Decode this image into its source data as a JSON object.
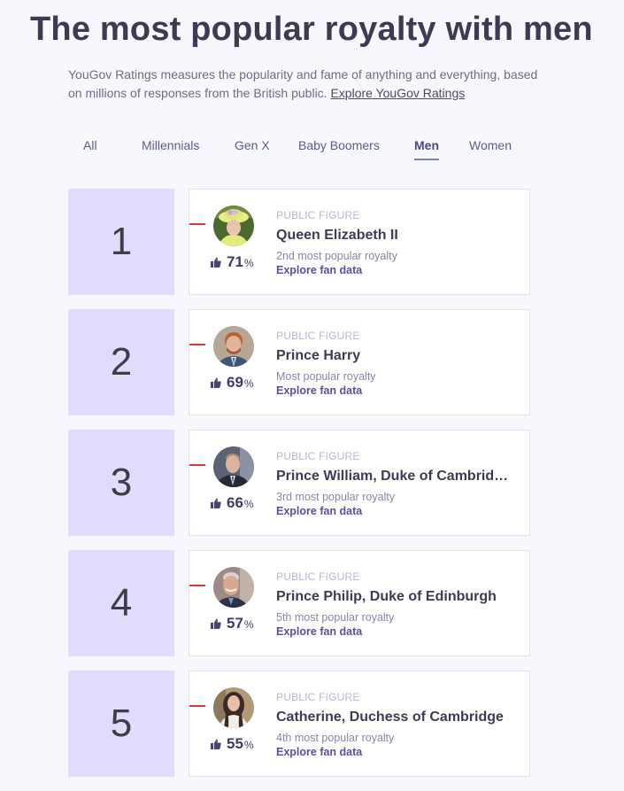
{
  "header": {
    "title": "The most popular royalty with men",
    "intro_text": "YouGov Ratings measures the popularity and fame of anything and everything, based on millions of responses from the British public.",
    "intro_link": "Explore YouGov Ratings"
  },
  "tabs": [
    {
      "label": "All",
      "active": false
    },
    {
      "label": "Millennials",
      "active": false
    },
    {
      "label": "Gen X",
      "active": false
    },
    {
      "label": "Baby Boomers",
      "active": false
    },
    {
      "label": "Men",
      "active": true
    },
    {
      "label": "Women",
      "active": false
    }
  ],
  "colors": {
    "rank_box": "#e1dcfc",
    "trend_marker": "#e2372f",
    "active_tab_underline": "#8078c9",
    "link": "#5b4f9a"
  },
  "rankings": [
    {
      "rank": "1",
      "category": "PUBLIC FIGURE",
      "name": "Queen Elizabeth II",
      "score": "71",
      "pct": "%",
      "subtitle": "2nd most popular royalty",
      "explore": "Explore fan data",
      "trend": "down",
      "avatar": "queen-elizabeth-photo"
    },
    {
      "rank": "2",
      "category": "PUBLIC FIGURE",
      "name": "Prince Harry",
      "score": "69",
      "pct": "%",
      "subtitle": "Most popular royalty",
      "explore": "Explore fan data",
      "trend": "down",
      "avatar": "prince-harry-photo"
    },
    {
      "rank": "3",
      "category": "PUBLIC FIGURE",
      "name": "Prince William, Duke of Cambrid…",
      "score": "66",
      "pct": "%",
      "subtitle": "3rd most popular royalty",
      "explore": "Explore fan data",
      "trend": "down",
      "avatar": "prince-william-photo"
    },
    {
      "rank": "4",
      "category": "PUBLIC FIGURE",
      "name": "Prince Philip, Duke of Edinburgh",
      "score": "57",
      "pct": "%",
      "subtitle": "5th most popular royalty",
      "explore": "Explore fan data",
      "trend": "down",
      "avatar": "prince-philip-photo"
    },
    {
      "rank": "5",
      "category": "PUBLIC FIGURE",
      "name": "Catherine, Duchess of Cambridge",
      "score": "55",
      "pct": "%",
      "subtitle": "4th most popular royalty",
      "explore": "Explore fan data",
      "trend": "down",
      "avatar": "catherine-photo"
    }
  ]
}
